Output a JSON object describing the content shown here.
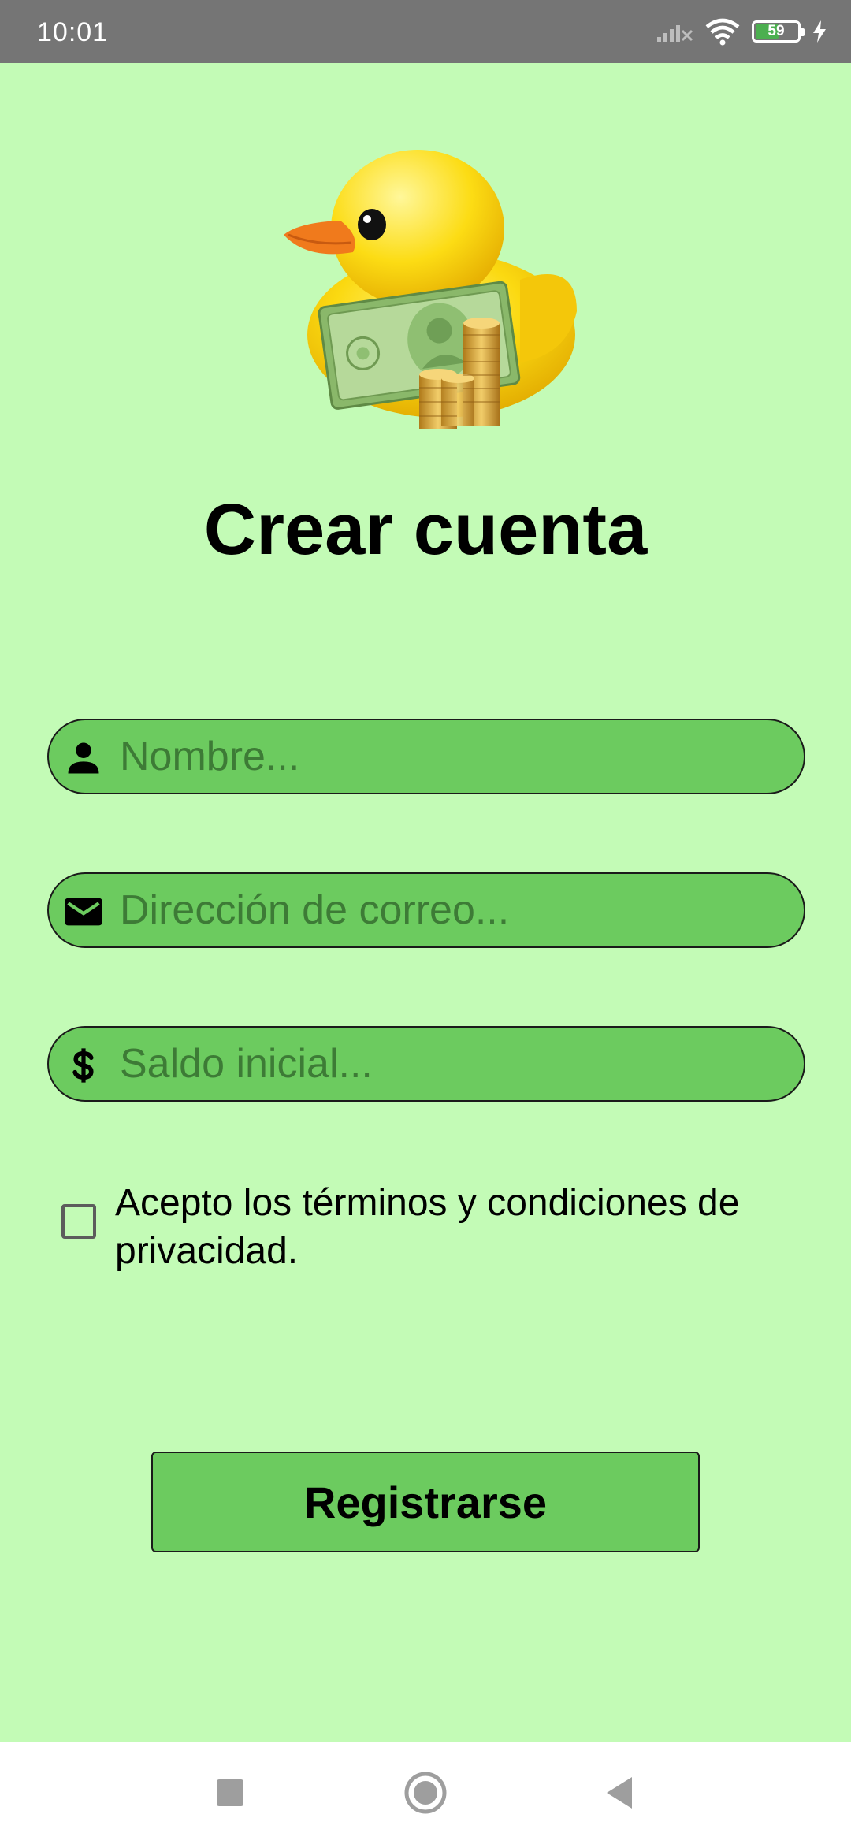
{
  "status_bar": {
    "time": "10:01",
    "battery_level": "59",
    "battery_fraction": 0.59,
    "icons": [
      "signal-off-icon",
      "wifi-icon",
      "battery-icon",
      "charging-bolt-icon"
    ]
  },
  "logo": {
    "icon": "duck-money-logo"
  },
  "title": "Crear cuenta",
  "form": {
    "name": {
      "icon": "person-icon",
      "value": "",
      "placeholder": "Nombre..."
    },
    "email": {
      "icon": "email-icon",
      "value": "",
      "placeholder": "Dirección de correo..."
    },
    "balance": {
      "icon": "dollar-icon",
      "value": "",
      "placeholder": "Saldo inicial..."
    },
    "terms": {
      "checked": false,
      "label": "Acepto los términos y condiciones de privacidad."
    },
    "submit_label": "Registrarse"
  },
  "nav_bar": {
    "items": [
      "recents-square-icon",
      "home-circle-icon",
      "back-triangle-icon"
    ]
  },
  "colors": {
    "background": "#c3fbb6",
    "field_fill": "#6ccb5f",
    "placeholder": "#3d7b36",
    "status_bar": "#757575",
    "battery": "#4caf50"
  }
}
